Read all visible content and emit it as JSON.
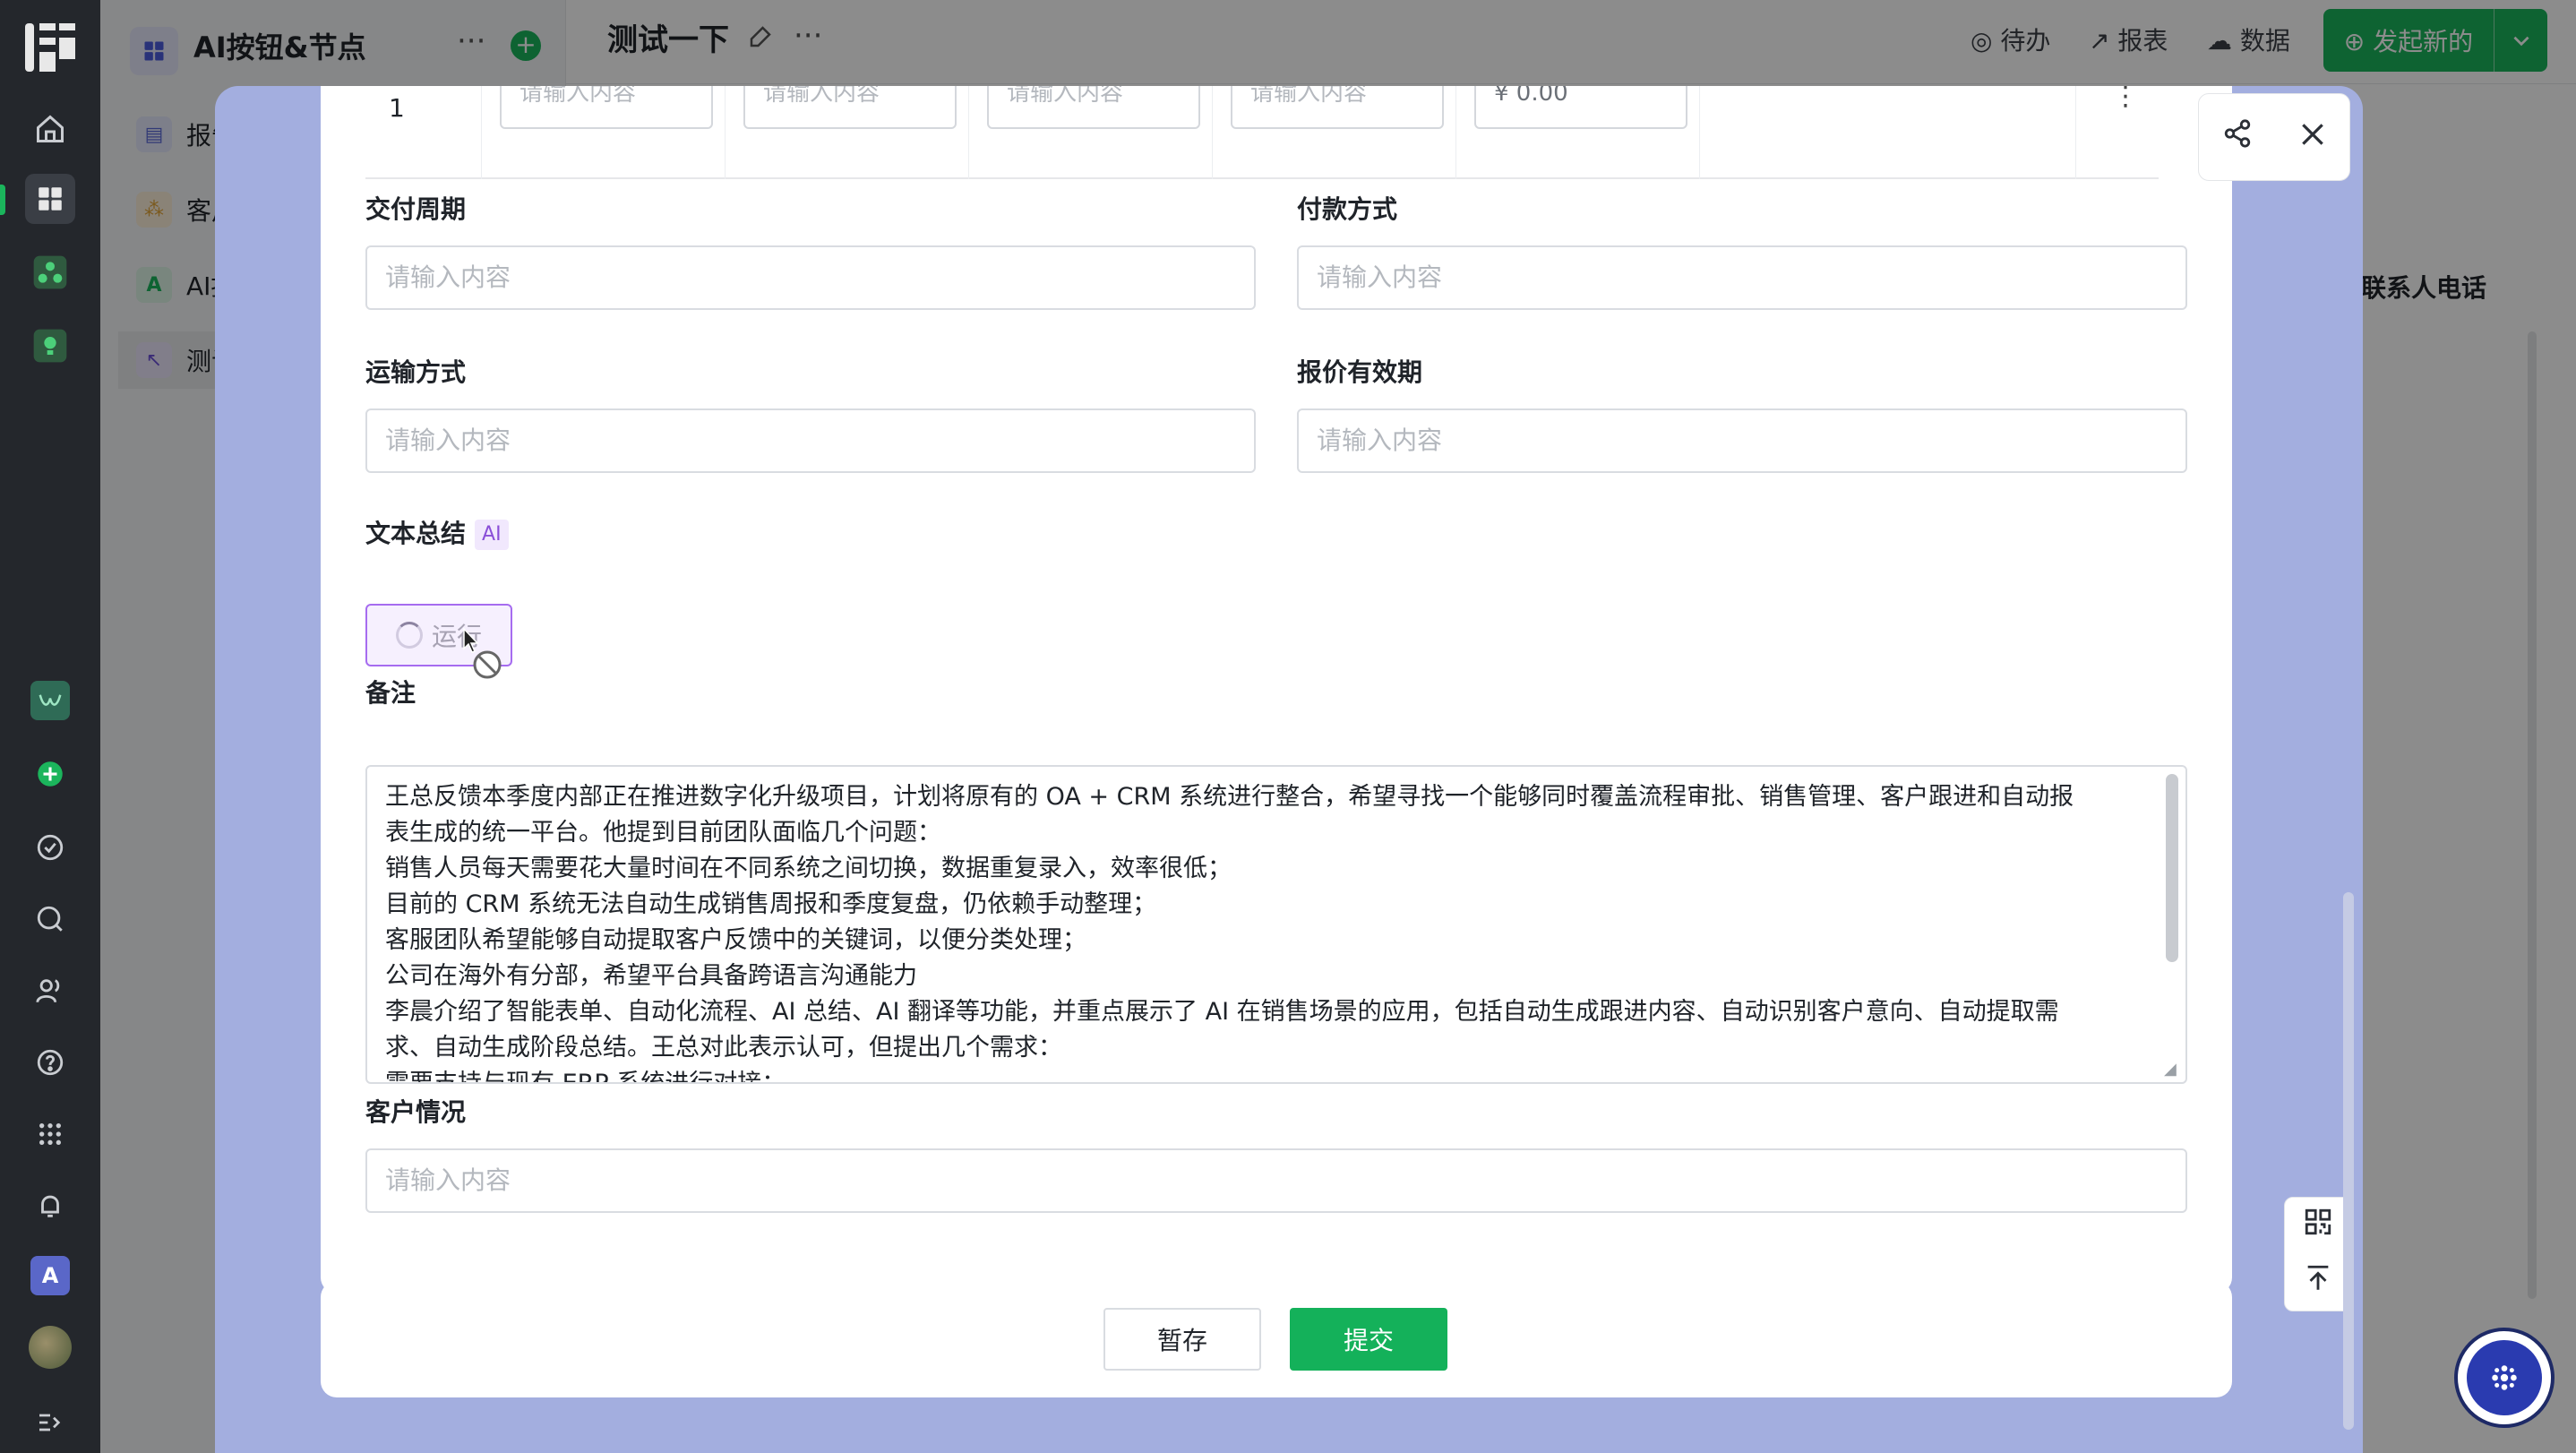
{
  "rail": {
    "logo": "☰",
    "icons": [
      "home-icon",
      "apps-icon",
      "org-icon",
      "bulb-icon"
    ],
    "lower_icons": [
      "check-circle-icon",
      "search-icon",
      "contacts-icon",
      "help-icon",
      "grid-icon",
      "bell-icon"
    ],
    "tile_letter": "A",
    "expand_icon": "expand-icon"
  },
  "app": {
    "title": "AI按钮&节点",
    "more": "···",
    "nav": [
      {
        "label": "报告",
        "icon_color": "#5b6bd8"
      },
      {
        "label": "客户",
        "icon_color": "#e0a236"
      },
      {
        "label": "AI按钮",
        "icon_color": "#1bb55c"
      },
      {
        "label": "测试一下",
        "icon_color": "#6a4fd8"
      }
    ]
  },
  "view": {
    "title": "测试一下",
    "toolbar": {
      "todo": "待办",
      "report": "报表",
      "data": "数据"
    },
    "start_button": "发起新的",
    "column_header": "联系人电话"
  },
  "form": {
    "table": {
      "row_number": "1",
      "placeholders": [
        "请输入内容",
        "请输入内容",
        "请输入内容",
        "请输入内容"
      ],
      "amount": "¥ 0.00",
      "row_action": "⋮"
    },
    "fields": {
      "delivery_cycle": {
        "label": "交付周期",
        "placeholder": "请输入内容"
      },
      "payment_method": {
        "label": "付款方式",
        "placeholder": "请输入内容"
      },
      "shipping_method": {
        "label": "运输方式",
        "placeholder": "请输入内容"
      },
      "quote_validity": {
        "label": "报价有效期",
        "placeholder": "请输入内容"
      },
      "text_summary": {
        "label": "文本总结",
        "ai_tag": "AI",
        "run_label": "运行"
      },
      "remarks": {
        "label": "备注",
        "lines": [
          "王总反馈本季度内部正在推进数字化升级项目，计划将原有的 OA + CRM 系统进行整合，希望寻找一个能够同时覆盖流程审批、销售管理、客户跟进和自动报",
          "表生成的统一平台。他提到目前团队面临几个问题：",
          "销售人员每天需要花大量时间在不同系统之间切换，数据重复录入，效率很低；",
          "目前的 CRM 系统无法自动生成销售周报和季度复盘，仍依赖手动整理；",
          "客服团队希望能够自动提取客户反馈中的关键词，以便分类处理；",
          "公司在海外有分部，希望平台具备跨语言沟通能力",
          "李晨介绍了智能表单、自动化流程、AI 总结、AI 翻译等功能，并重点展示了 AI 在销售场景的应用，包括自动生成跟进内容、自动识别客户意向、自动提取需",
          "求、自动生成阶段总结。王总对此表示认可，但提出几个需求：",
          "需要支持与现有 ERP 系统进行对接；"
        ]
      },
      "customer_status": {
        "label": "客户情况",
        "placeholder": "请输入内容"
      }
    },
    "footer": {
      "save": "暂存",
      "submit": "提交"
    }
  }
}
